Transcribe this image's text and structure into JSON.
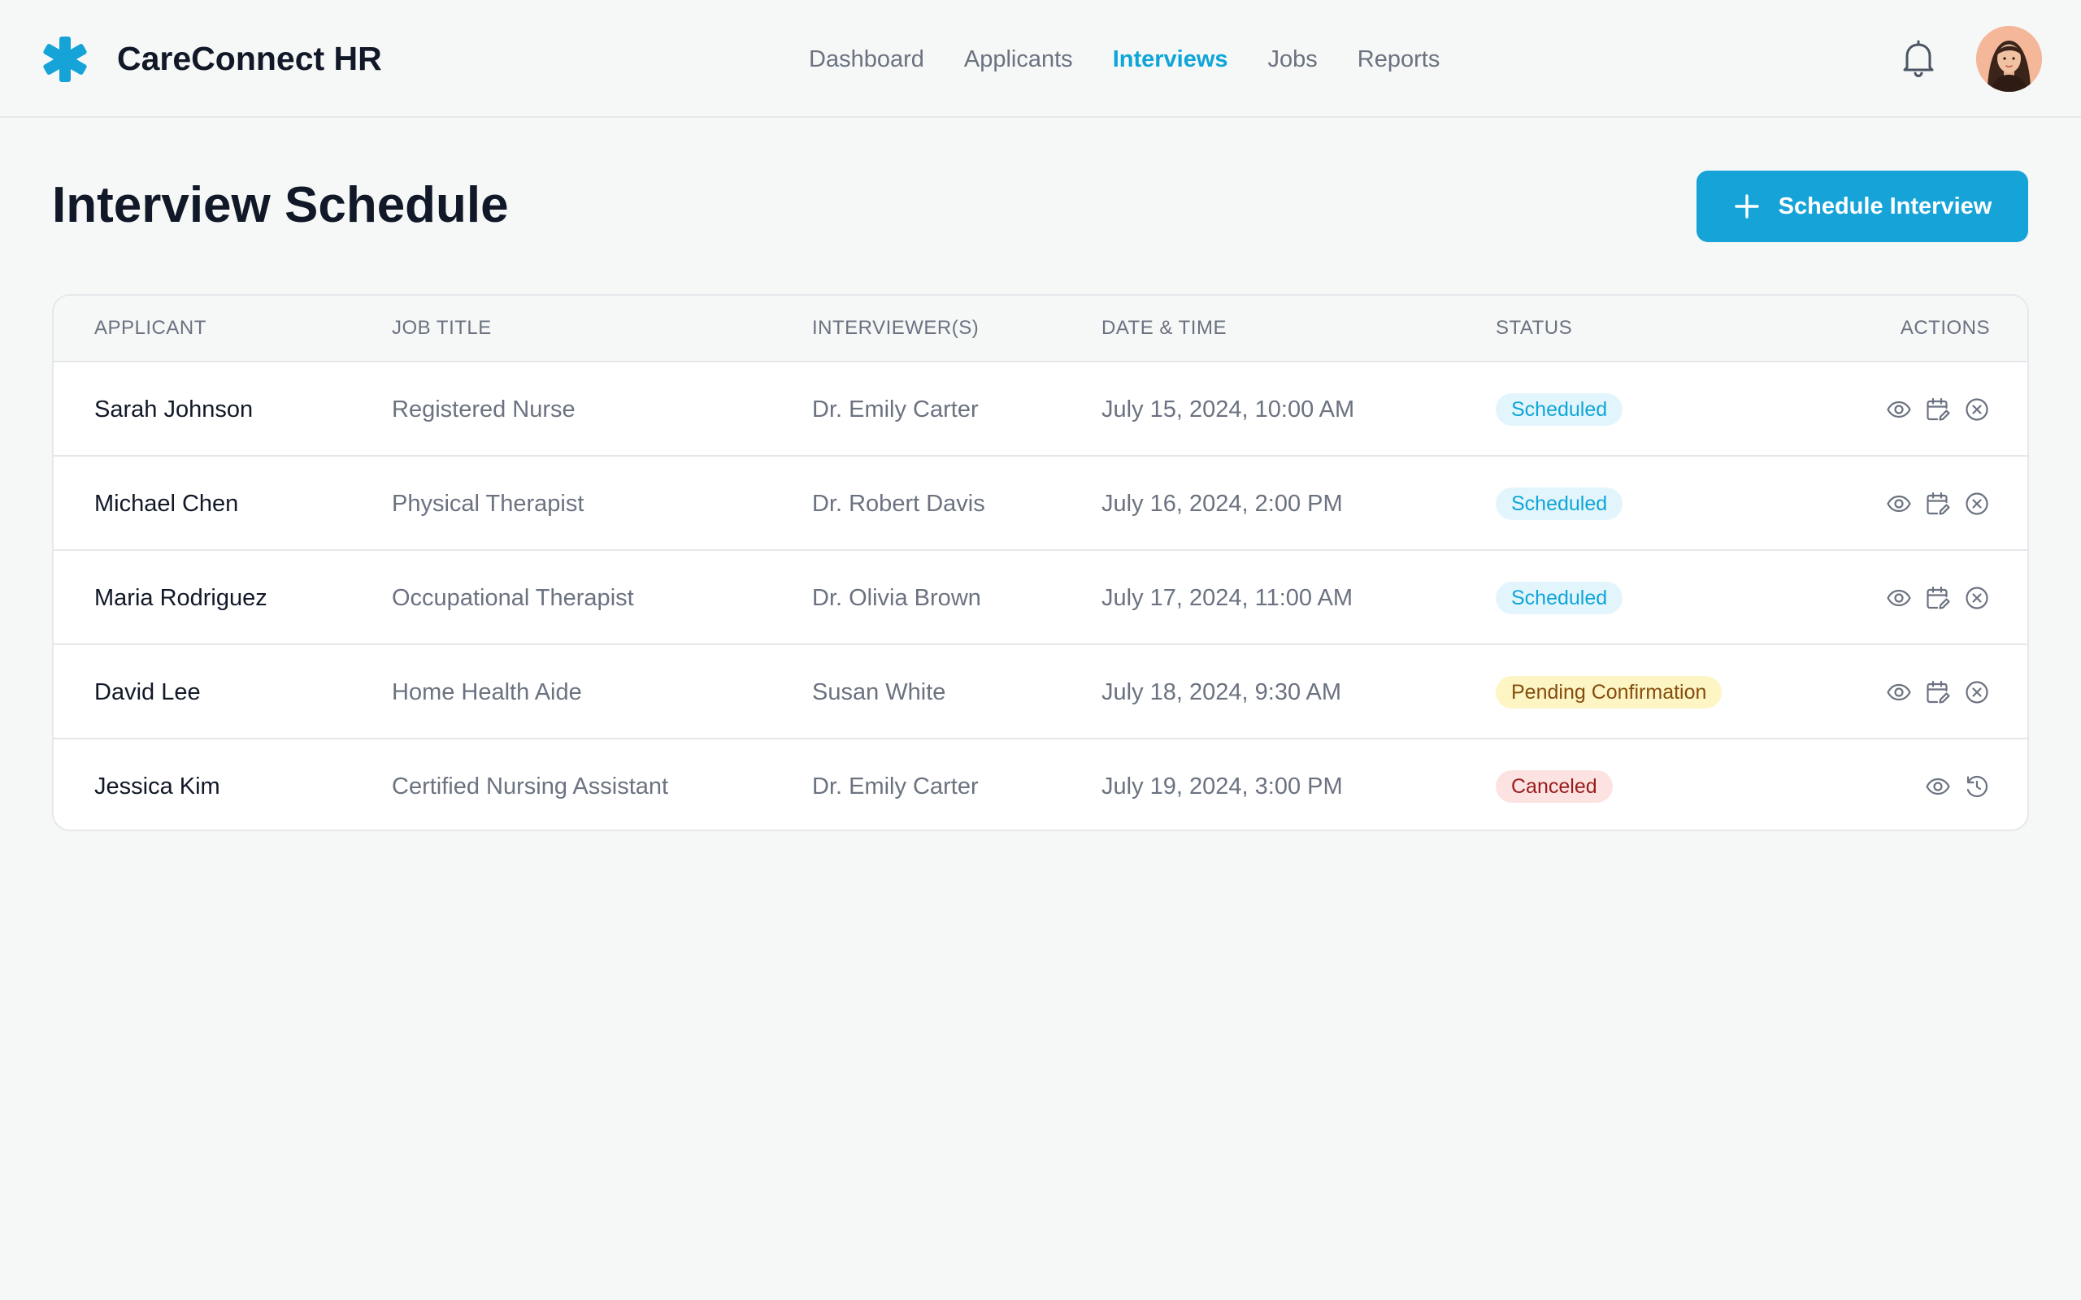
{
  "app": {
    "brand": "CareConnect HR",
    "accent_color": "#16a3d8",
    "logo_icon": "medical-asterisk-icon"
  },
  "nav": {
    "items": [
      {
        "label": "Dashboard",
        "active": false
      },
      {
        "label": "Applicants",
        "active": false
      },
      {
        "label": "Interviews",
        "active": true
      },
      {
        "label": "Jobs",
        "active": false
      },
      {
        "label": "Reports",
        "active": false
      }
    ],
    "notification_icon": "bell-icon",
    "avatar_icon": "user-avatar"
  },
  "page": {
    "title": "Interview Schedule",
    "primary_action": "Schedule Interview",
    "primary_action_icon": "plus-icon"
  },
  "table": {
    "headers": {
      "applicant": "APPLICANT",
      "job_title": "JOB TITLE",
      "interviewers": "INTERVIEWER(S)",
      "datetime": "DATE & TIME",
      "status": "STATUS",
      "actions": "ACTIONS"
    },
    "rows": [
      {
        "applicant": "Sarah Johnson",
        "job_title": "Registered Nurse",
        "interviewers": "Dr. Emily Carter",
        "datetime": "July 15, 2024, 10:00 AM",
        "status": "Scheduled",
        "status_type": "scheduled",
        "actions": [
          "view-icon",
          "reschedule-icon",
          "cancel-icon"
        ]
      },
      {
        "applicant": "Michael Chen",
        "job_title": "Physical Therapist",
        "interviewers": "Dr. Robert Davis",
        "datetime": "July 16, 2024, 2:00 PM",
        "status": "Scheduled",
        "status_type": "scheduled",
        "actions": [
          "view-icon",
          "reschedule-icon",
          "cancel-icon"
        ]
      },
      {
        "applicant": "Maria Rodriguez",
        "job_title": "Occupational Therapist",
        "interviewers": "Dr. Olivia Brown",
        "datetime": "July 17, 2024, 11:00 AM",
        "status": "Scheduled",
        "status_type": "scheduled",
        "actions": [
          "view-icon",
          "reschedule-icon",
          "cancel-icon"
        ]
      },
      {
        "applicant": "David Lee",
        "job_title": "Home Health Aide",
        "interviewers": "Susan White",
        "datetime": "July 18, 2024, 9:30 AM",
        "status": "Pending Confirmation",
        "status_type": "pending",
        "actions": [
          "view-icon",
          "reschedule-icon",
          "cancel-icon"
        ]
      },
      {
        "applicant": "Jessica Kim",
        "job_title": "Certified Nursing Assistant",
        "interviewers": "Dr. Emily Carter",
        "datetime": "July 19, 2024, 3:00 PM",
        "status": "Canceled",
        "status_type": "canceled",
        "actions": [
          "view-icon",
          "restore-icon"
        ]
      }
    ]
  },
  "status_colors": {
    "scheduled": "#0ea5d8",
    "pending": "#854d0e",
    "canceled": "#991b1b"
  }
}
